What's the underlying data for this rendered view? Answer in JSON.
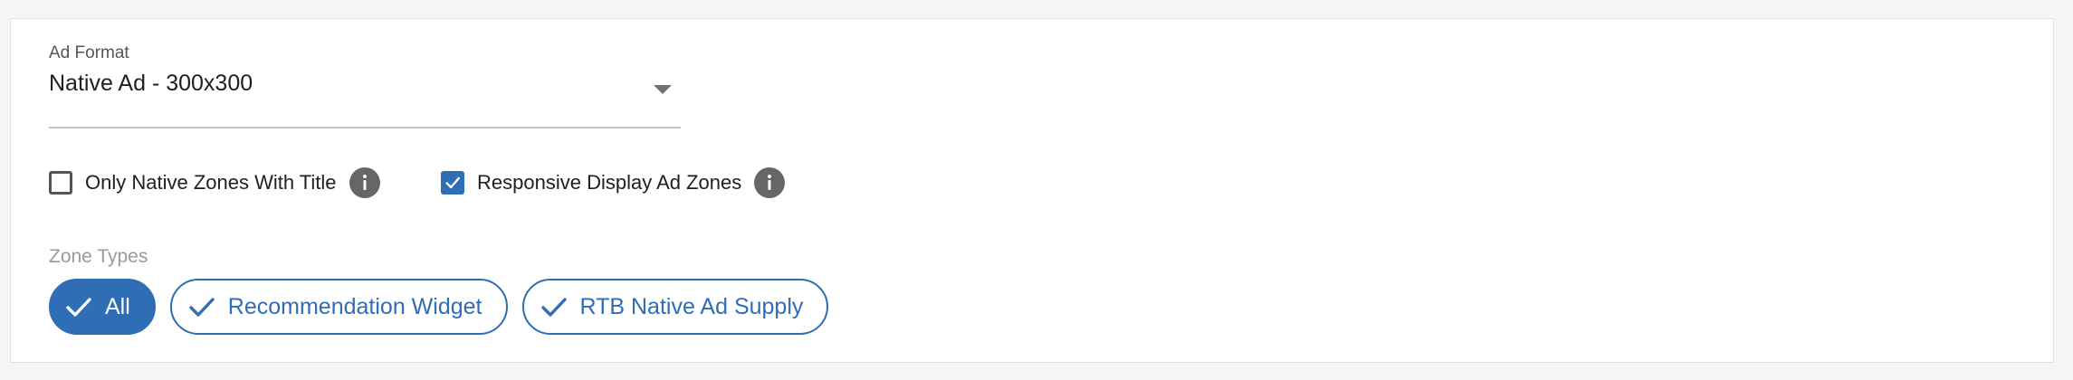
{
  "ad_format": {
    "label": "Ad Format",
    "value": "Native Ad - 300x300"
  },
  "options": [
    {
      "label": "Only Native Zones With Title",
      "checked": false,
      "info_icon": "info-icon"
    },
    {
      "label": "Responsive Display Ad Zones",
      "checked": true,
      "info_icon": "info-icon"
    }
  ],
  "zone_types": {
    "label": "Zone Types",
    "chips": [
      {
        "label": "All",
        "selected": true,
        "icon": "check-icon"
      },
      {
        "label": "Recommendation Widget",
        "selected": true,
        "icon": "check-icon"
      },
      {
        "label": "RTB Native Ad Supply",
        "selected": true,
        "icon": "check-icon"
      }
    ]
  },
  "colors": {
    "accent": "#2f6db5",
    "info_icon": "#666666",
    "muted_label": "#9a9a9a"
  }
}
